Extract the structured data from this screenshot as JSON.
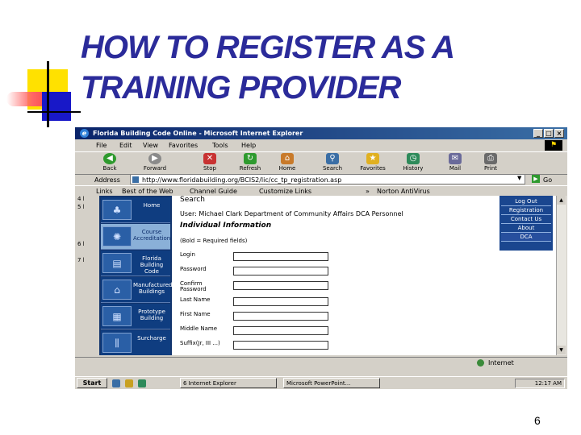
{
  "slide": {
    "title": "HOW TO REGISTER AS A TRAINING PROVIDER",
    "page_number": "6"
  },
  "browser": {
    "window_title": "Florida Building Code Online - Microsoft Internet Explorer",
    "window_buttons": {
      "minimize": "_",
      "maximize": "□",
      "close": "×"
    },
    "menus": [
      "File",
      "Edit",
      "View",
      "Favorites",
      "Tools",
      "Help"
    ],
    "toolbar": [
      {
        "label": "Back",
        "icon": "back-arrow-icon",
        "color": "#2e9a2e"
      },
      {
        "label": "Forward",
        "icon": "forward-arrow-icon",
        "color": "#8a8a8a"
      },
      {
        "label": "Stop",
        "icon": "stop-icon",
        "color": "#c83232"
      },
      {
        "label": "Refresh",
        "icon": "refresh-icon",
        "color": "#2e9a2e"
      },
      {
        "label": "Home",
        "icon": "home-icon",
        "color": "#c87a2a"
      },
      {
        "label": "Search",
        "icon": "search-icon",
        "color": "#3a6ea5"
      },
      {
        "label": "Favorites",
        "icon": "star-icon",
        "color": "#e0b020"
      },
      {
        "label": "History",
        "icon": "history-icon",
        "color": "#2e8a5a"
      },
      {
        "label": "Mail",
        "icon": "mail-icon",
        "color": "#6a6a9a"
      },
      {
        "label": "Print",
        "icon": "print-icon",
        "color": "#6a6a6a"
      }
    ],
    "address_label": "Address",
    "address_url": "http://www.floridabuilding.org/BCIS2/lic/cc_tp_registration.asp",
    "go_label": "Go",
    "links_label": "Links",
    "links": [
      "Best of the Web",
      "Channel Guide",
      "Customize Links"
    ],
    "norton_label": "Norton AntiVirus",
    "status_text": "Internet",
    "left_gutter": [
      "4 l",
      "5 l",
      "6 l",
      "7 l"
    ]
  },
  "sidebar": {
    "items": [
      {
        "label": "Home",
        "icon": "palm-tree-icon",
        "active": false
      },
      {
        "label": "Course Accreditation",
        "icon": "seal-icon",
        "active": true
      },
      {
        "label": "Florida Building Code",
        "icon": "book-icon",
        "active": false
      },
      {
        "label": "Manufactured Buildings",
        "icon": "house-icon",
        "active": false
      },
      {
        "label": "Prototype Building",
        "icon": "building-icon",
        "active": false
      },
      {
        "label": "Surcharge",
        "icon": "columns-icon",
        "active": false
      }
    ]
  },
  "content": {
    "search_label": "Search",
    "user_line": "User: Michael Clark   Department of Community Affairs   DCA Personnel",
    "section_heading": "Individual Information",
    "required_note": "(Bold = Required fields)",
    "fields": [
      {
        "label": "Login",
        "value": ""
      },
      {
        "label": "Password",
        "value": ""
      },
      {
        "label": "Confirm Password",
        "value": ""
      },
      {
        "label": "Last Name",
        "value": ""
      },
      {
        "label": "First Name",
        "value": ""
      },
      {
        "label": "Middle Name",
        "value": ""
      },
      {
        "label": "Suffix(Jr, III ...)",
        "value": ""
      }
    ]
  },
  "right_nav": {
    "items": [
      "Log Out",
      "Registration",
      "Contact Us",
      "About",
      "DCA"
    ]
  },
  "taskbar": {
    "start_label": "Start",
    "tasks": [
      "6 Internet Explorer",
      "Microsoft PowerPoint..."
    ],
    "clock": "12:17 AM"
  }
}
